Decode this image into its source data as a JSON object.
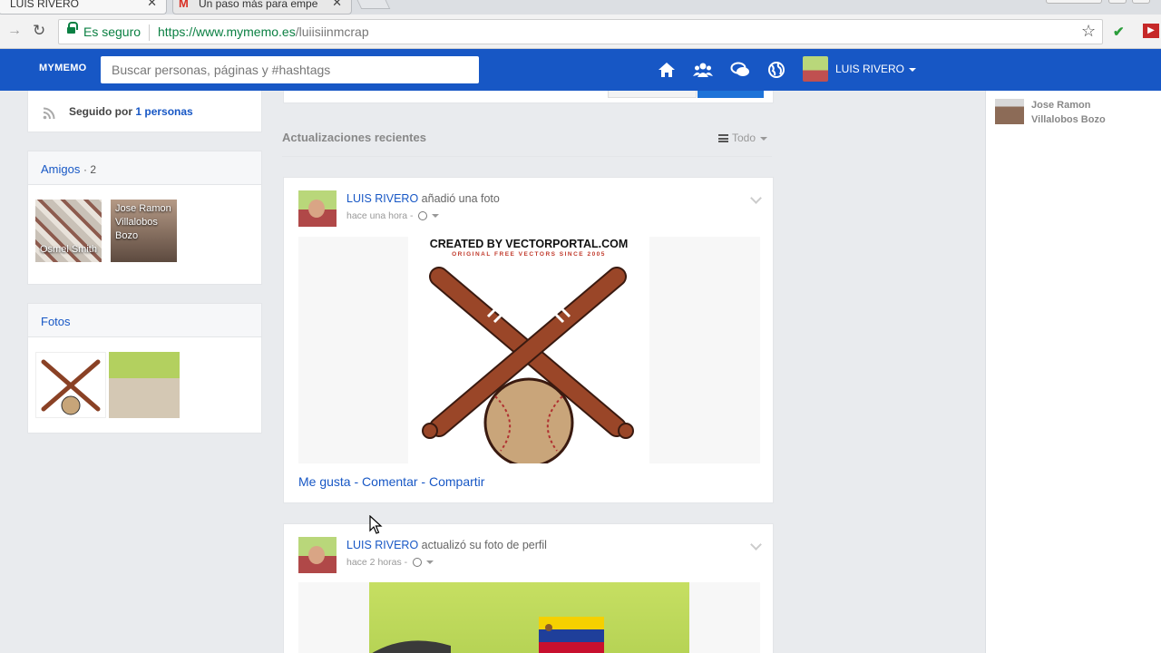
{
  "browser": {
    "tabs": [
      {
        "label": "LUIS RIVERO",
        "active": true
      },
      {
        "label": "Un paso más para empe",
        "active": false
      }
    ],
    "secure_label": "Es seguro",
    "url_host": "https://www.mymemo.es",
    "url_path": "/luiisiinmcrap"
  },
  "header": {
    "logo": "MYMEMO",
    "search_placeholder": "Buscar personas, páginas y #hashtags",
    "user_name": "LUIS RIVERO",
    "accent": "#1757c5"
  },
  "left": {
    "followed_prefix": "Seguido por",
    "followed_count": "1",
    "followed_suffix": "personas",
    "friends_title": "Amigos",
    "friends_count": "· 2",
    "friends": [
      {
        "name": "Osmel Smith"
      },
      {
        "name": "Jose Ramon Villalobos Bozo"
      }
    ],
    "photos_title": "Fotos"
  },
  "feed": {
    "section_title": "Actualizaciones recientes",
    "filter_label": "Todo",
    "posts": [
      {
        "author": "LUIS RIVERO",
        "action": "añadió una foto",
        "time": "hace una hora -",
        "image_header": "CREATED BY VECTORPORTAL.COM",
        "image_subheader": "ORIGINAL FREE VECTORS SINCE 2005",
        "like": "Me gusta",
        "comment": "Comentar",
        "share": "Compartir"
      },
      {
        "author": "LUIS RIVERO",
        "action": "actualizó su foto de perfil",
        "time": "hace 2 horas -"
      }
    ]
  },
  "right": {
    "contact_name": "Jose Ramon Villalobos Bozo"
  }
}
